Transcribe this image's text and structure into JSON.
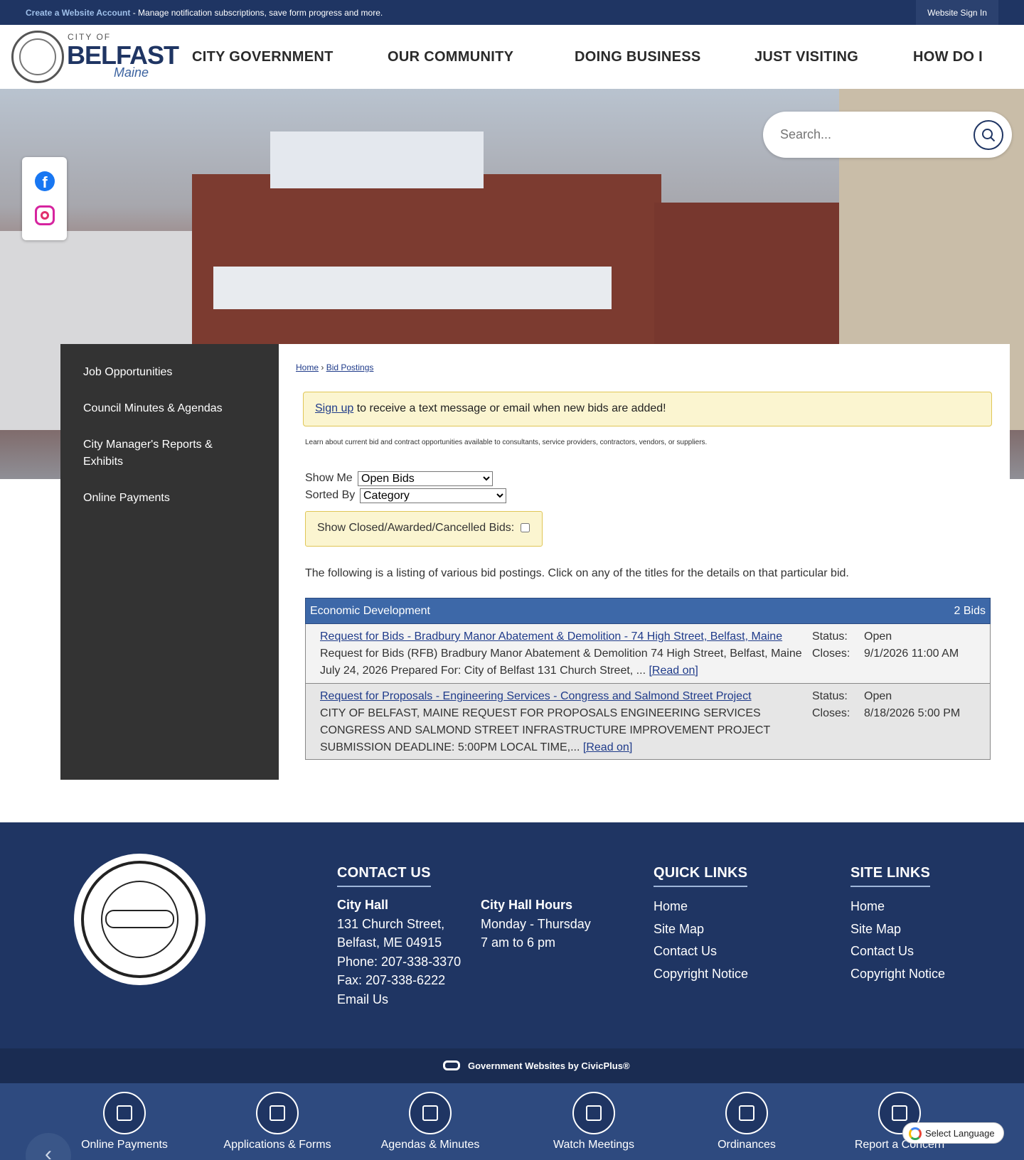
{
  "topbar": {
    "create_account": "Create a Website Account",
    "message": " - Manage notification subscriptions, save form progress and more.",
    "sign_in": "Website Sign In"
  },
  "logo": {
    "city_of": "CITY OF",
    "name": "BELFAST",
    "state": "Maine"
  },
  "nav": [
    "CITY GOVERNMENT",
    "OUR COMMUNITY",
    "DOING BUSINESS",
    "JUST VISITING",
    "HOW DO I"
  ],
  "search": {
    "placeholder": "Search..."
  },
  "social": {
    "facebook": "f"
  },
  "sidebar": {
    "items": [
      "Job Opportunities",
      "Council Minutes & Agendas",
      "City Manager's Reports & Exhibits",
      "Online Payments"
    ]
  },
  "breadcrumb": {
    "home": "Home",
    "sep": "›",
    "current": "Bid Postings"
  },
  "signup": {
    "link": "Sign up",
    "text": " to receive a text message or email when new bids are added!"
  },
  "intro": "Learn about current bid and contract opportunities available to consultants, service providers, contractors, vendors, or suppliers.",
  "filters": {
    "show_me_label": "Show Me",
    "show_me_value": "Open Bids",
    "sorted_by_label": "Sorted By",
    "sorted_by_value": "Category",
    "closed_label": "Show Closed/Awarded/Cancelled Bids:"
  },
  "listing_text": "The following is a listing of various bid postings. Click on any of the titles for the details on that particular bid.",
  "bids": {
    "category": "Economic Development",
    "count": "2 Bids",
    "status_label": "Status:",
    "closes_label": "Closes:",
    "read_on": "[Read on]",
    "rows": [
      {
        "title": "Request for Bids - Bradbury Manor Abatement & Demolition - 74 High Street, Belfast, Maine",
        "desc": "Request for Bids (RFB) Bradbury Manor Abatement & Demolition 74 High Street, Belfast, Maine July 24, 2026 Prepared For: City of Belfast 131 Church Street, ... ",
        "status": "Open",
        "closes": "9/1/2026 11:00 AM"
      },
      {
        "title": "Request for Proposals - Engineering Services - Congress and Salmond Street Project",
        "desc": "CITY OF BELFAST, MAINE REQUEST FOR PROPOSALS ENGINEERING SERVICES CONGRESS AND SALMOND STREET INFRASTRUCTURE IMPROVEMENT PROJECT SUBMISSION DEADLINE: 5:00PM LOCAL TIME,... ",
        "status": "Open",
        "closes": "8/18/2026 5:00 PM"
      }
    ]
  },
  "footer": {
    "contact_heading": "CONTACT US",
    "city_hall": "City Hall",
    "address1": "131 Church Street,",
    "address2": "Belfast, ME 04915",
    "phone": "Phone: 207-338-3370",
    "fax": "Fax: 207-338-6222",
    "email": "Email Us",
    "hours_heading": "City Hall Hours",
    "hours_days": "Monday - Thursday",
    "hours_time": "7 am to 6 pm",
    "quick_heading": "QUICK LINKS",
    "quick_links": [
      "Home",
      "Site Map",
      "Contact Us",
      "Copyright Notice"
    ],
    "site_heading": "SITE LINKS",
    "site_links": [
      "Home",
      "Site Map",
      "Contact Us",
      "Copyright Notice"
    ],
    "civicplus": "Government Websites by CivicPlus®"
  },
  "quick_bar": [
    "Online Payments",
    "Applications & Forms",
    "Agendas & Minutes",
    "Watch Meetings",
    "Ordinances",
    "Report a Concern"
  ],
  "language": "Select Language",
  "colors": {
    "navy": "#1f3563",
    "bid_header": "#3d68a8",
    "notice_bg": "#fbf5d0"
  }
}
